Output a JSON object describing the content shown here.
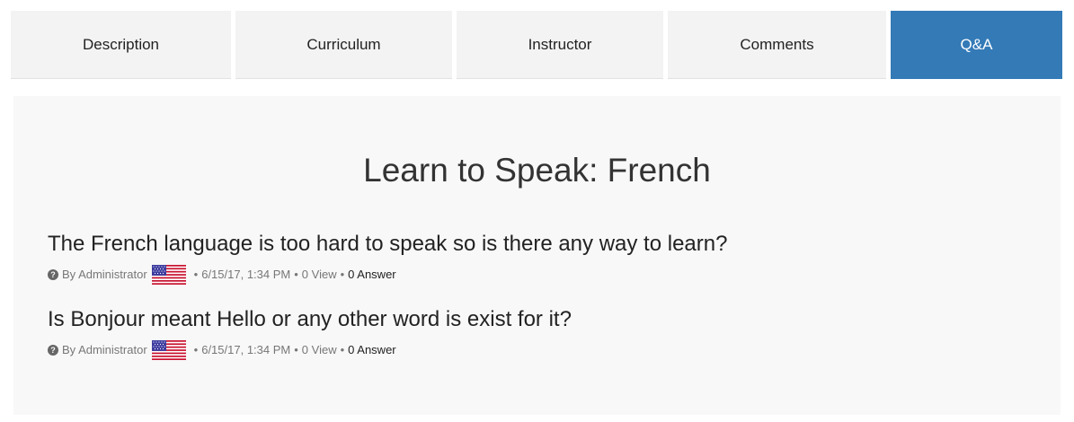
{
  "tabs": [
    {
      "label": "Description",
      "active": false
    },
    {
      "label": "Curriculum",
      "active": false
    },
    {
      "label": "Instructor",
      "active": false
    },
    {
      "label": "Comments",
      "active": false
    },
    {
      "label": "Q&A",
      "active": true
    }
  ],
  "colors": {
    "accent": "#337ab7",
    "tab_bg": "#f3f3f3",
    "panel_bg": "#f8f8f8"
  },
  "panel": {
    "title": "Learn to Speak: French"
  },
  "questions": [
    {
      "title": "The French language is too hard to speak so is there any way to learn?",
      "author": "By Administrator",
      "flag_icon": "us-flag-icon",
      "date": "6/15/17, 1:34 PM",
      "views": "0 View",
      "answers": "0 Answer"
    },
    {
      "title": "Is Bonjour meant Hello or any other word is exist for it?",
      "author": "By Administrator",
      "flag_icon": "us-flag-icon",
      "date": "6/15/17, 1:34 PM",
      "views": "0 View",
      "answers": "0 Answer"
    }
  ]
}
